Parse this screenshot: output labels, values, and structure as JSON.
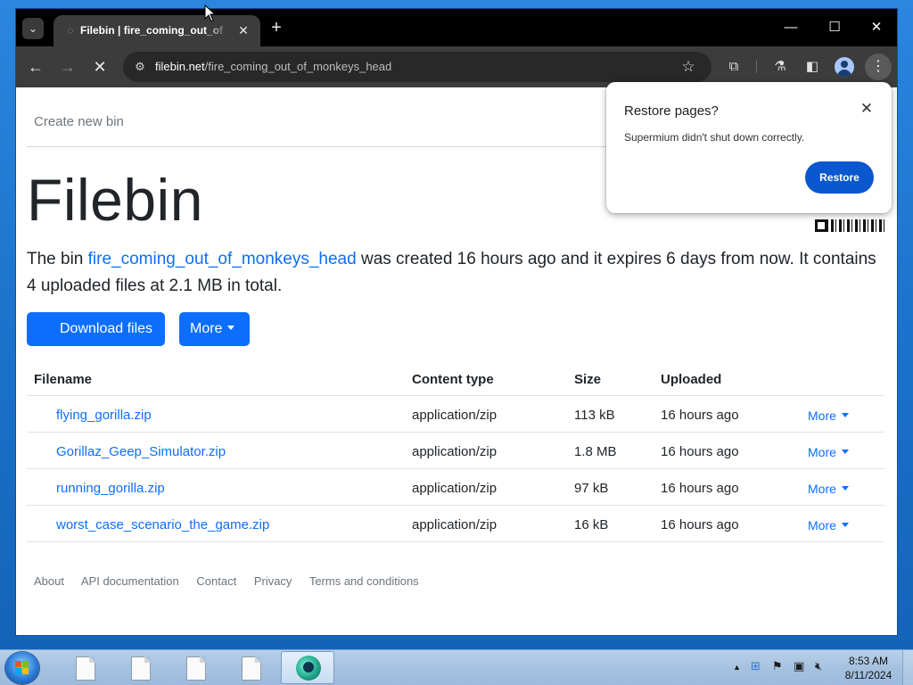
{
  "browser": {
    "tab_title": "Filebin | fire_coming_out_of_monkeys_head",
    "url_host": "filebin.net",
    "url_path": "/fire_coming_out_of_monkeys_head",
    "tab_dropdown_icon": "chevron-down",
    "new_tab_label": "+",
    "tab_close_label": "✕"
  },
  "page": {
    "nav_create": "Create new bin",
    "title": "Filebin",
    "lead": {
      "prefix": "The bin ",
      "bin_name": "fire_coming_out_of_monkeys_head",
      "suffix": " was created 16 hours ago and it expires 6 days from now. It contains 4 uploaded files at 2.1 MB in total."
    },
    "download_button": "Download files",
    "more_button": "More",
    "table": {
      "headers": [
        "Filename",
        "Content type",
        "Size",
        "Uploaded"
      ],
      "rows": [
        {
          "name": "flying_gorilla.zip",
          "type": "application/zip",
          "size": "113 kB",
          "uploaded": "16 hours ago",
          "more": "More"
        },
        {
          "name": "Gorillaz_Geep_Simulator.zip",
          "type": "application/zip",
          "size": "1.8 MB",
          "uploaded": "16 hours ago",
          "more": "More"
        },
        {
          "name": "running_gorilla.zip",
          "type": "application/zip",
          "size": "97 kB",
          "uploaded": "16 hours ago",
          "more": "More"
        },
        {
          "name": "worst_case_scenario_the_game.zip",
          "type": "application/zip",
          "size": "16 kB",
          "uploaded": "16 hours ago",
          "more": "More"
        }
      ]
    },
    "footer": [
      "About",
      "API documentation",
      "Contact",
      "Privacy",
      "Terms and conditions"
    ]
  },
  "popup": {
    "title": "Restore pages?",
    "message": "Supermium didn't shut down correctly.",
    "button": "Restore"
  },
  "taskbar": {
    "time": "8:53 AM",
    "date": "8/11/2024"
  },
  "colors": {
    "link": "#0d6efd",
    "primary_button": "#0d6efd",
    "restore_button": "#0b57d0",
    "tabbar": "#000000",
    "toolbar": "#3c3c3c"
  }
}
